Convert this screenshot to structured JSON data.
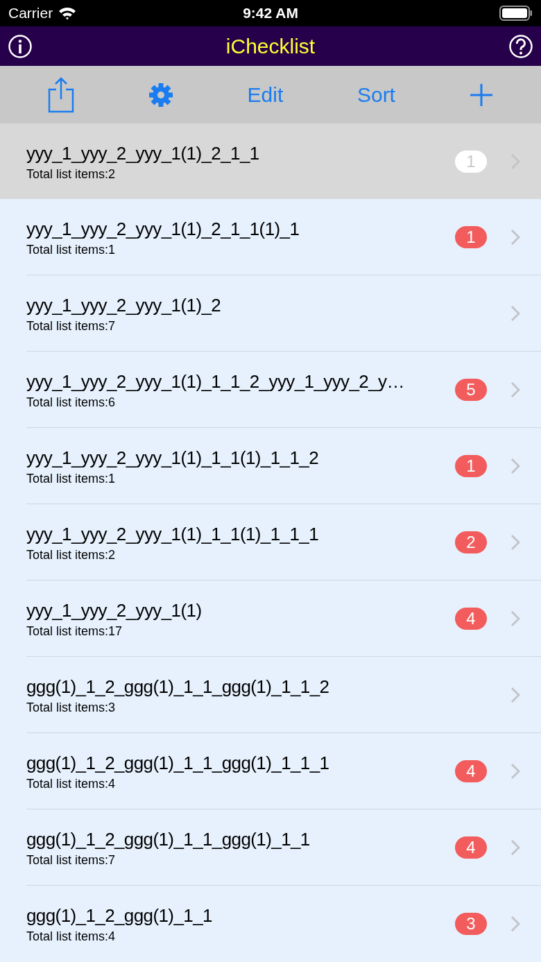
{
  "status_bar": {
    "carrier": "Carrier",
    "time": "9:42 AM"
  },
  "nav": {
    "title": "iChecklist"
  },
  "toolbar": {
    "edit": "Edit",
    "sort": "Sort"
  },
  "lists": [
    {
      "title": "yyy_1_yyy_2_yyy_1(1)_2_1_1",
      "subtitle": "Total list items:2",
      "badge": "1",
      "selected": true
    },
    {
      "title": "yyy_1_yyy_2_yyy_1(1)_2_1_1(1)_1",
      "subtitle": "Total list items:1",
      "badge": "1",
      "selected": false
    },
    {
      "title": "yyy_1_yyy_2_yyy_1(1)_2",
      "subtitle": "Total list items:7",
      "selected": false
    },
    {
      "title": "yyy_1_yyy_2_yyy_1(1)_1_1_2_yyy_1_yyy_2_y…",
      "subtitle": "Total list items:6",
      "badge": "5",
      "selected": false
    },
    {
      "title": "yyy_1_yyy_2_yyy_1(1)_1_1(1)_1_1_2",
      "subtitle": "Total list items:1",
      "badge": "1",
      "selected": false
    },
    {
      "title": "yyy_1_yyy_2_yyy_1(1)_1_1(1)_1_1_1",
      "subtitle": "Total list items:2",
      "badge": "2",
      "selected": false
    },
    {
      "title": "yyy_1_yyy_2_yyy_1(1)",
      "subtitle": "Total list items:17",
      "badge": "4",
      "selected": false
    },
    {
      "title": "ggg(1)_1_2_ggg(1)_1_1_ggg(1)_1_1_2",
      "subtitle": "Total list items:3",
      "selected": false
    },
    {
      "title": "ggg(1)_1_2_ggg(1)_1_1_ggg(1)_1_1_1",
      "subtitle": "Total list items:4",
      "badge": "4",
      "selected": false
    },
    {
      "title": "ggg(1)_1_2_ggg(1)_1_1_ggg(1)_1_1",
      "subtitle": "Total list items:7",
      "badge": "4",
      "selected": false
    },
    {
      "title": "ggg(1)_1_2_ggg(1)_1_1",
      "subtitle": "Total list items:4",
      "badge": "3",
      "selected": false
    }
  ]
}
